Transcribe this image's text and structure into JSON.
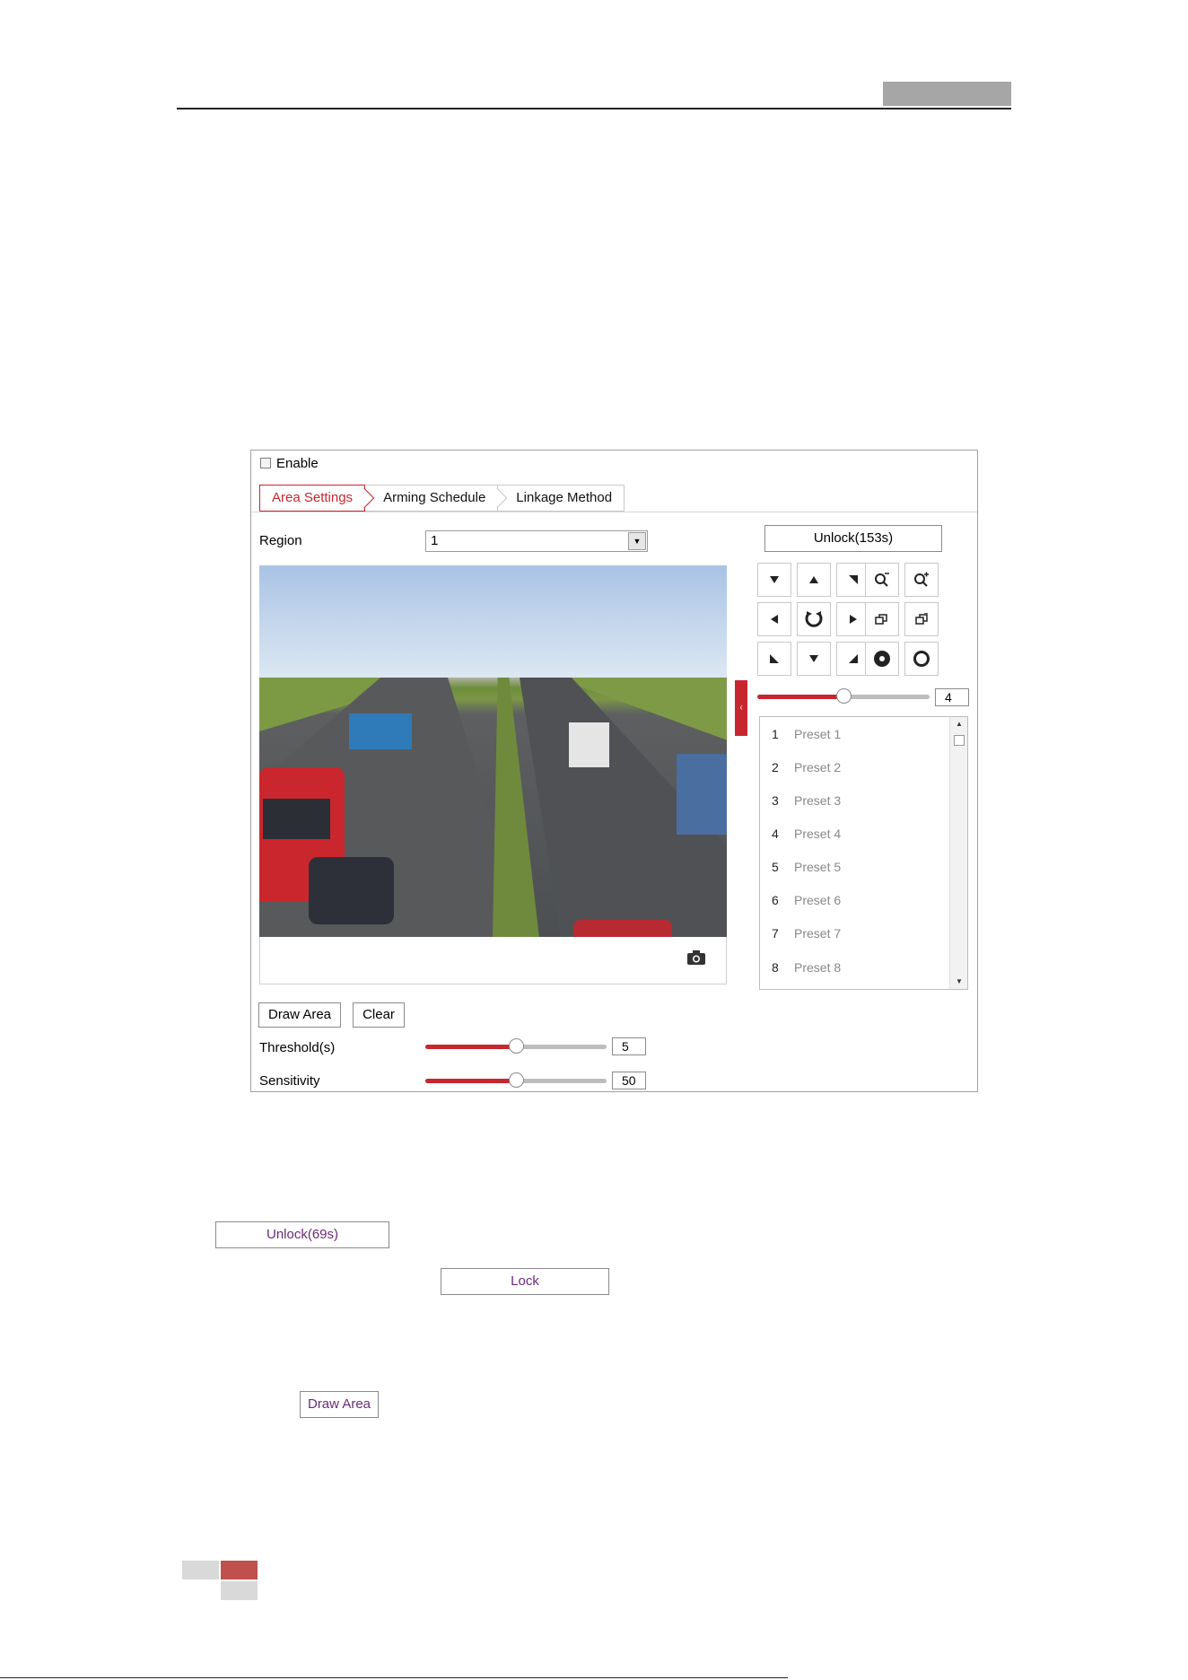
{
  "shot": {
    "enable_label": "Enable",
    "tabs": [
      {
        "label": "Area Settings",
        "active": true
      },
      {
        "label": "Arming Schedule",
        "active": false
      },
      {
        "label": "Linkage Method",
        "active": false
      }
    ],
    "region_label": "Region",
    "region_value": "1",
    "unlock_label": "Unlock(153s)",
    "ptz_speed": "4",
    "ptz_speed_fraction": 0.5,
    "presets": [
      {
        "num": "1",
        "name": "Preset 1"
      },
      {
        "num": "2",
        "name": "Preset 2"
      },
      {
        "num": "3",
        "name": "Preset 3"
      },
      {
        "num": "4",
        "name": "Preset 4"
      },
      {
        "num": "5",
        "name": "Preset 5"
      },
      {
        "num": "6",
        "name": "Preset 6"
      },
      {
        "num": "7",
        "name": "Preset 7"
      },
      {
        "num": "8",
        "name": "Preset 8"
      }
    ],
    "draw_area_label": "Draw Area",
    "clear_label": "Clear",
    "threshold_label": "Threshold(s)",
    "threshold_value": "5",
    "threshold_fraction": 0.5,
    "sensitivity_label": "Sensitivity",
    "sensitivity_value": "50",
    "sensitivity_fraction": 0.5
  },
  "page_buttons": {
    "unlock": "Unlock(69s)",
    "lock": "Lock",
    "draw_area": "Draw Area"
  },
  "colors": {
    "accent": "#c8262f",
    "header_tab": "#a6a6a6",
    "footer_light": "#d9d9d9",
    "footer_red": "#c0504d"
  }
}
